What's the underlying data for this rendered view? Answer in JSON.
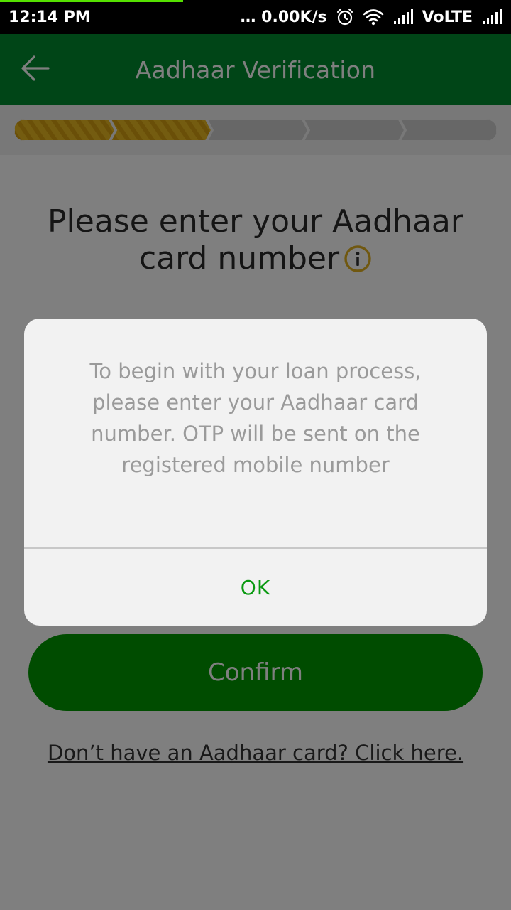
{
  "status_bar": {
    "time": "12:14 PM",
    "network_speed": "… 0.00K/s",
    "carrier": "VoLTE",
    "icons": [
      "alarm-icon",
      "wifi-icon",
      "signal-icon",
      "signal-icon"
    ]
  },
  "app_bar": {
    "title": "Aadhaar Verification",
    "back_icon": "back-arrow-icon"
  },
  "stepper": {
    "total_steps": 5,
    "completed_steps": 2
  },
  "main": {
    "headline": "Please enter your Aadhaar card number",
    "info_icon": "info-icon",
    "confirm_label": "Confirm",
    "no_aadhaar_link": "Don’t have an Aadhaar card? Click here."
  },
  "dialog": {
    "message": "To begin with your loan process, please enter your Aadhaar card number. OTP will be sent on the registered mobile number",
    "ok_label": "OK"
  },
  "colors": {
    "primary_green": "#008a2e",
    "button_green": "#009900",
    "step_done": "#e8b820",
    "step_pending": "#cfcfcf",
    "ok_text": "#0b9a12"
  }
}
